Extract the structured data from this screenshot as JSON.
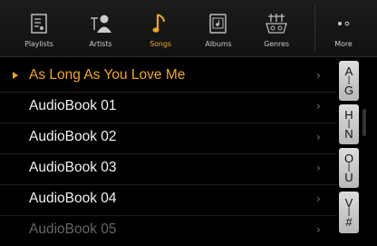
{
  "tabs": [
    {
      "label": "Playlists",
      "icon": "playlist-icon"
    },
    {
      "label": "Artists",
      "icon": "artists-icon"
    },
    {
      "label": "Songs",
      "icon": "music-note-icon"
    },
    {
      "label": "Albums",
      "icon": "album-icon"
    },
    {
      "label": "Genres",
      "icon": "genres-icon"
    },
    {
      "label": "More",
      "icon": "more-dots-icon"
    }
  ],
  "active_tab": "Songs",
  "accent_color": "#f0a81c",
  "list": {
    "items": [
      {
        "label": "As Long As You Love Me"
      },
      {
        "label": "AudioBook 01"
      },
      {
        "label": "AudioBook 02"
      },
      {
        "label": "AudioBook 03"
      },
      {
        "label": "AudioBook 04"
      },
      {
        "label": "AudioBook 05"
      }
    ],
    "chevron": "›"
  },
  "index": [
    {
      "top": "A",
      "bottom": "G"
    },
    {
      "top": "H",
      "bottom": "N"
    },
    {
      "top": "O",
      "bottom": "U"
    },
    {
      "top": "V",
      "bottom": "#"
    }
  ]
}
